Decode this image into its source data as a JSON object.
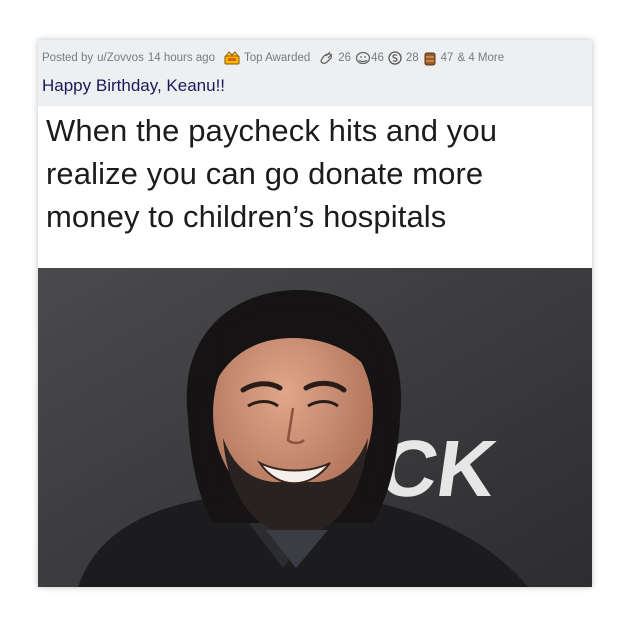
{
  "post": {
    "posted_by_prefix": "Posted by",
    "author": "u/Zovvos",
    "time_ago": "14 hours ago",
    "top_awarded_label": "Top Awarded",
    "awards": [
      {
        "icon": "helping-hand-icon",
        "count": "26"
      },
      {
        "icon": "wholesome-icon",
        "count": "46"
      },
      {
        "icon": "silver-coin-icon",
        "count": "28"
      },
      {
        "icon": "trophy-bear-icon",
        "count": "47"
      }
    ],
    "more_label": "& 4 More",
    "title": "Happy Birthday, Keanu!!"
  },
  "meme": {
    "caption_lines": [
      "When the paycheck hits and you",
      "realize you can go donate more",
      "money to children’s hospitals"
    ],
    "backdrop_text": "ICK",
    "backdrop_top": "I"
  },
  "colors": {
    "header_bg": "#edeff1",
    "meta_text": "#787c7e",
    "title_text": "#1a1a5a",
    "photo_bg": "#3f3f41"
  }
}
